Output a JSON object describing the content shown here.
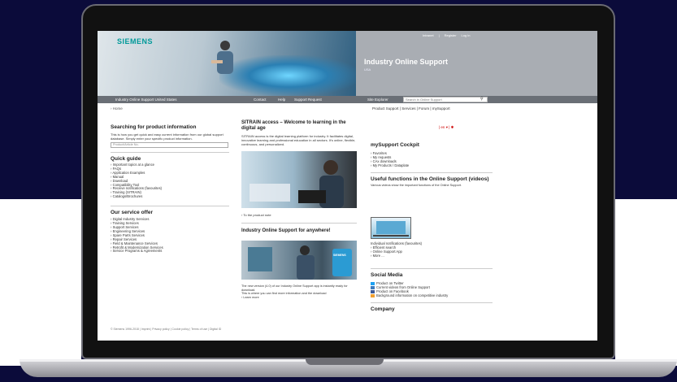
{
  "header": {
    "brand": "SIEMENS",
    "title": "Industry Online Support",
    "subtitle": "USA",
    "top_links": [
      "Intranet",
      "Register",
      "Log in"
    ]
  },
  "nav": {
    "left": "Industry Online Support United States",
    "contact": "Contact",
    "help": "Help",
    "support_request": "Support Request",
    "site_explorer": "Site Explorer",
    "search_placeholder": "Search in Online Support"
  },
  "breadcrumb": "Home",
  "right_links": [
    "Product Support",
    "Services",
    "Forum",
    "mySupport"
  ],
  "lang": "en",
  "left_col": {
    "search_title": "Searching for product information",
    "search_desc": "This is how you get quick and easy current information from our global support database. Simply enter your specific product information.",
    "product_input_placeholder": "Product/Article No.",
    "quick_guide_title": "Quick guide",
    "quick_guide": [
      "Important topics at a glance",
      "FAQs",
      "Application Examples",
      "Manual",
      "Download",
      "Compatibility Tool",
      "Receive notifications (favourites)",
      "Training (SITRAIN)",
      "Catalogs/Brochures"
    ],
    "service_title": "Our service offer",
    "services": [
      "Digital Industry Services",
      "Training Services",
      "Support Services",
      "Engineering Services",
      "Spare Parts Services",
      "Repair Services",
      "Field & Maintenance Services",
      "Retrofit & Modernization Services",
      "Service Programs & Agreements"
    ]
  },
  "mid_col": {
    "sitrain_title": "SITRAIN access – Welcome to learning in the digital age",
    "sitrain_text": "SITRAIN access is the digital learning platform for industry. It facilitates digital, innovative learning and professional education in all sectors. It's online, flexible, continuous, and personalized.",
    "product_note": "To the product note",
    "anywhere_title": "Industry Online Support for anywhere!",
    "badge": "SIEMENS",
    "app_text": "The new version (4.0) of our Industry Online Support app is instantly ready for download.",
    "app_text2": "This is where you can find more information and the download",
    "learn_more": "Learn more"
  },
  "right_col": {
    "cockpit_title": "mySupport Cockpit",
    "cockpit_links": [
      "Favorites",
      "My requests",
      "CAx downloads",
      "My Products / Dataplate"
    ],
    "useful_title": "Useful functions in the Online Support (videos)",
    "useful_desc": "Various videos show the important functions of the Online Support.",
    "video_links": [
      "Individual notifications (favourites)",
      "Efficient search",
      "Online Support App",
      "More ..."
    ],
    "social_title": "Social Media",
    "social_links": [
      "Product on Twitter",
      "Current videos from Online Support",
      "Product on Facebook",
      "Background information on competitive industry"
    ],
    "company_title": "Company"
  },
  "footer": "© Siemens 1996-2018  |  Imprint  |  Privacy policy  |  Cookie policy  |  Terms of use  |  Digital ID",
  "colors": {
    "brand": "#009999",
    "nav": "#6a6f76",
    "header": "#a9adb3",
    "background": "#0b0b3a"
  }
}
